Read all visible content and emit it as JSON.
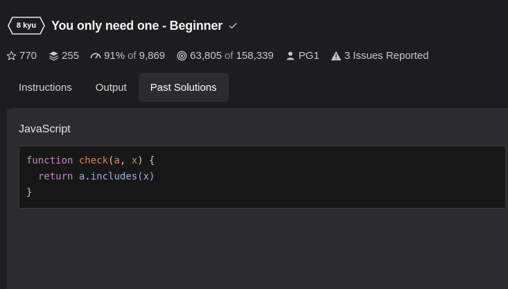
{
  "header": {
    "rank": "8 kyu",
    "title": "You only need one - Beginner"
  },
  "stats": {
    "stars": "770",
    "collections": "255",
    "satisfaction": "91%",
    "satisfaction_of": "of",
    "satisfaction_total": "9,869",
    "completed": "63,805",
    "completed_of": "of",
    "completed_total": "158,339",
    "author": "PG1",
    "issues": "3 Issues Reported"
  },
  "tabs": [
    {
      "label": "Instructions"
    },
    {
      "label": "Output"
    },
    {
      "label": "Past Solutions"
    }
  ],
  "solution": {
    "language": "JavaScript",
    "code": {
      "line1_kw": "function",
      "line1_fn": "check",
      "line1_open": "(",
      "line1_a": "a",
      "line1_comma": ", ",
      "line1_x": "x",
      "line1_close": ") {",
      "line2_indent": "  ",
      "line2_kw": "return",
      "line2_obj": " a",
      "line2_dot": ".",
      "line2_method": "includes",
      "line2_args": "(x)",
      "line3": "}"
    }
  },
  "colors": {
    "background": "#1d1d1f",
    "panel": "#2c2c2f",
    "code_bg": "#171717",
    "keyword": "#c586c0",
    "function": "#e3834a"
  }
}
